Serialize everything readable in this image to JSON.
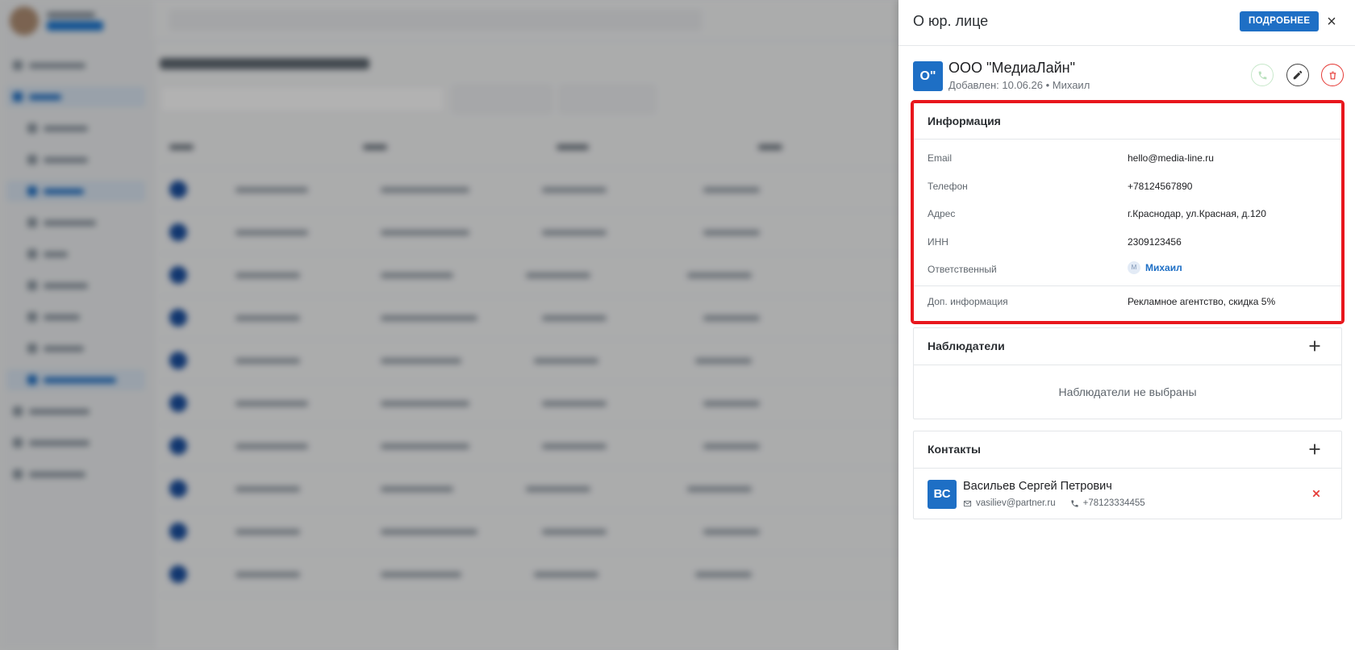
{
  "drawer": {
    "title": "О юр. лице",
    "more_label": "ПОДРОБНЕЕ",
    "close_label": "×"
  },
  "entity": {
    "avatar_initials": "О\"",
    "name": "ООО \"МедиаЛайн\"",
    "meta": "Добавлен: 10.06.26 • Михаил"
  },
  "info": {
    "title": "Информация",
    "rows": [
      {
        "label": "Email",
        "value": "hello@media-line.ru"
      },
      {
        "label": "Телефон",
        "value": "+78124567890"
      },
      {
        "label": "Адрес",
        "value": "г.Краснодар, ул.Красная, д.120"
      },
      {
        "label": "ИНН",
        "value": "2309123456"
      }
    ],
    "responsible": {
      "label": "Ответственный",
      "avatar": "М",
      "name": "Михаил"
    },
    "extra": {
      "label": "Доп. информация",
      "value": "Рекламное агентство, скидка 5%"
    }
  },
  "observers": {
    "title": "Наблюдатели",
    "empty": "Наблюдатели не выбраны"
  },
  "contacts": {
    "title": "Контакты",
    "items": [
      {
        "initials": "ВС",
        "name": "Васильев Сергей Петрович",
        "email": "vasiliev@partner.ru",
        "phone": "+78123334455"
      }
    ]
  },
  "colors": {
    "accent": "#1e6fc5",
    "danger": "#e53935",
    "highlight": "#e8161c"
  }
}
